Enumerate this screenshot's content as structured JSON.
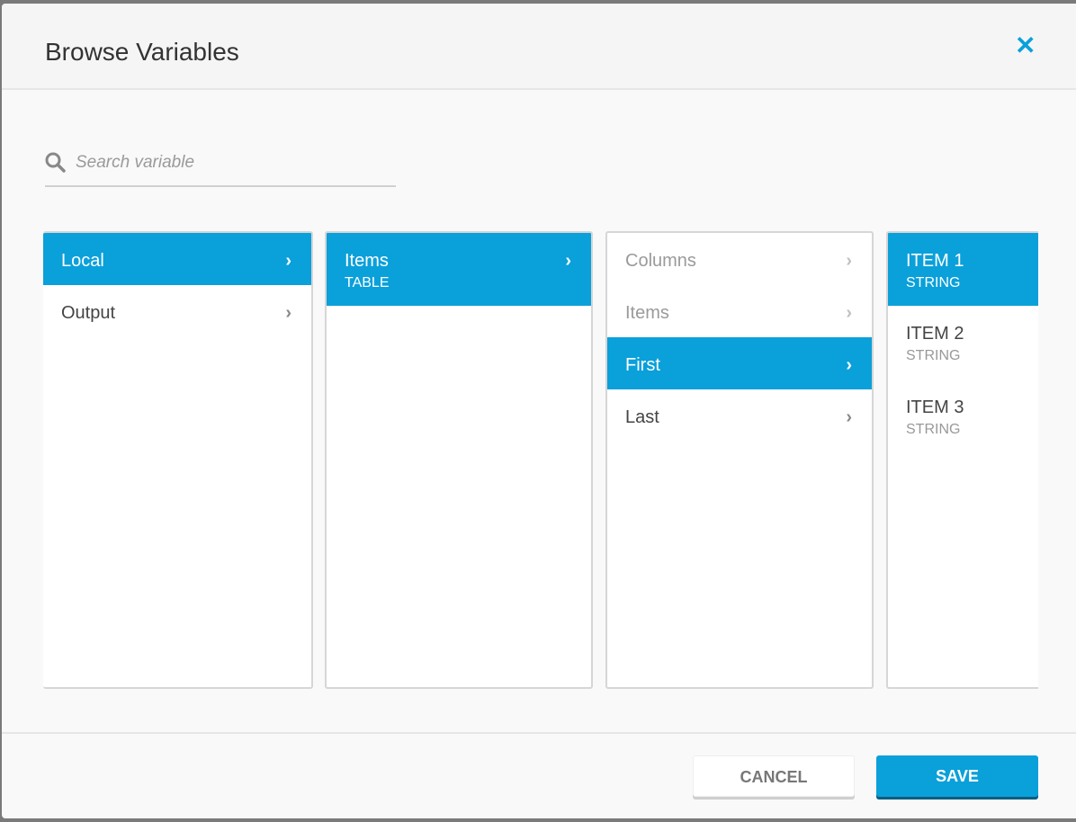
{
  "dialog": {
    "title": "Browse Variables",
    "close_icon": "close-icon"
  },
  "search": {
    "placeholder": "Search variable",
    "value": ""
  },
  "columns": [
    [
      {
        "label": "Local",
        "selected": true
      },
      {
        "label": "Output"
      }
    ],
    [
      {
        "label": "Items",
        "type": "TABLE",
        "selected": true
      }
    ],
    [
      {
        "label": "Columns",
        "disabled": true
      },
      {
        "label": "Items",
        "disabled": true
      },
      {
        "label": "First",
        "selected": true
      },
      {
        "label": "Last"
      }
    ],
    [
      {
        "label": "ITEM 1",
        "type": "STRING",
        "selected": true
      },
      {
        "label": "ITEM 2",
        "type": "STRING"
      },
      {
        "label": "ITEM 3",
        "type": "STRING"
      }
    ]
  ],
  "footer": {
    "cancel": "CANCEL",
    "save": "SAVE"
  },
  "colors": {
    "accent": "#0aa0da"
  }
}
